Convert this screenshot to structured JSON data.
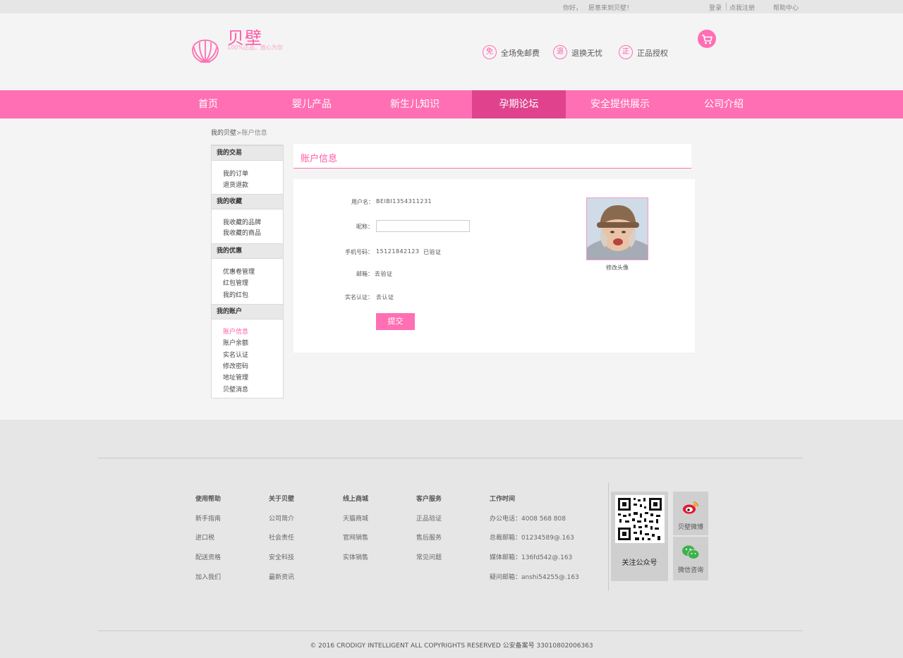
{
  "topbar": {
    "greeting": "你好，",
    "welcome": "愿意来到贝壁！",
    "login": "登录",
    "register": "点我注册",
    "help": "帮助中心"
  },
  "brand": {
    "name": "贝壁",
    "slogan": "100%正品，放心为您",
    "color": "#ff5aa8"
  },
  "features": [
    {
      "icon": "免",
      "label": "全场免邮费"
    },
    {
      "icon": "退",
      "label": "退换无忧"
    },
    {
      "icon": "正",
      "label": "正品授权"
    }
  ],
  "nav": {
    "items": [
      "首页",
      "婴儿产品",
      "新生儿知识",
      "孕期论坛",
      "安全提供展示",
      "公司介绍"
    ],
    "active": "孕期论坛"
  },
  "breadcrumb": {
    "root": "我的贝壁",
    "separator": ">",
    "current": "账户信息"
  },
  "sidebar": {
    "groups": [
      {
        "title": "我的交易",
        "links": [
          "我的订单",
          "退货退款"
        ]
      },
      {
        "title": "我的收藏",
        "links": [
          "我收藏的品牌",
          "我收藏的商品"
        ]
      },
      {
        "title": "我的优惠",
        "links": [
          "优惠卷管理",
          "红包管理",
          "我的红包"
        ]
      },
      {
        "title": "我的账户",
        "links": [
          "账户信息",
          "账户余额",
          "实名认证",
          "修改密码",
          "地址管理",
          "贝壁消息"
        ]
      }
    ],
    "selected": "账户信息"
  },
  "account": {
    "title": "账户信息",
    "username_label": "用户名：",
    "username": "BEIBI1354311231",
    "nickname_label": "昵称：",
    "nickname_value": "",
    "phone_label": "手机号码：",
    "phone": "15121842123",
    "phone_status": "已验证",
    "email_label": "邮箱：",
    "email_action": "去验证",
    "realname_label": "实名认证：",
    "realname_action": "去认证",
    "submit": "提交",
    "avatar_action": "修改头像"
  },
  "footer": {
    "columns": [
      {
        "title": "使用帮助",
        "links": [
          "新手指南",
          "进口税",
          "配送资格",
          "加入我们"
        ]
      },
      {
        "title": "关于贝壁",
        "links": [
          "公司简介",
          "社会责任",
          "安全科技",
          "最新资讯"
        ]
      },
      {
        "title": "线上商城",
        "links": [
          "天猫商城",
          "官网销售",
          "实体销售"
        ]
      },
      {
        "title": "客户服务",
        "links": [
          "正品验证",
          "售后服务",
          "常见问题"
        ]
      },
      {
        "title": "工作时间",
        "links": [
          "办公电话：4008 568 808",
          "总裁邮箱：01234589@.163",
          "媒体邮箱：136fd542@.163",
          "疑问邮箱：anshi54255@.163"
        ]
      }
    ],
    "qr_label": "关注公众号",
    "weibo": "贝壁微博",
    "wechat": "微信咨询",
    "copyright": "©  2016  CRODIGY INTELLIGENT ALL COPYRIGHTS RESERVED     公安备案号 33010802006363"
  }
}
